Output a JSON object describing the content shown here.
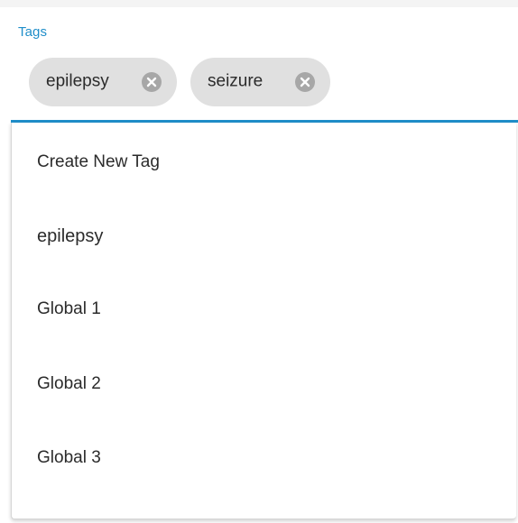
{
  "field": {
    "label": "Tags",
    "chips": [
      {
        "label": "epilepsy",
        "remove_icon": "close-circle-icon"
      },
      {
        "label": "seizure",
        "remove_icon": "close-circle-icon"
      }
    ]
  },
  "menu": {
    "items": [
      {
        "label": "Create New Tag"
      },
      {
        "label": "epilepsy"
      },
      {
        "label": "Global 1"
      },
      {
        "label": "Global 2"
      },
      {
        "label": "Global 3"
      }
    ]
  },
  "colors": {
    "accent": "#1f8ec9",
    "chip_bg": "#e0e0e0",
    "chip_icon": "#a7a7a7",
    "text": "#2b2b2b"
  }
}
